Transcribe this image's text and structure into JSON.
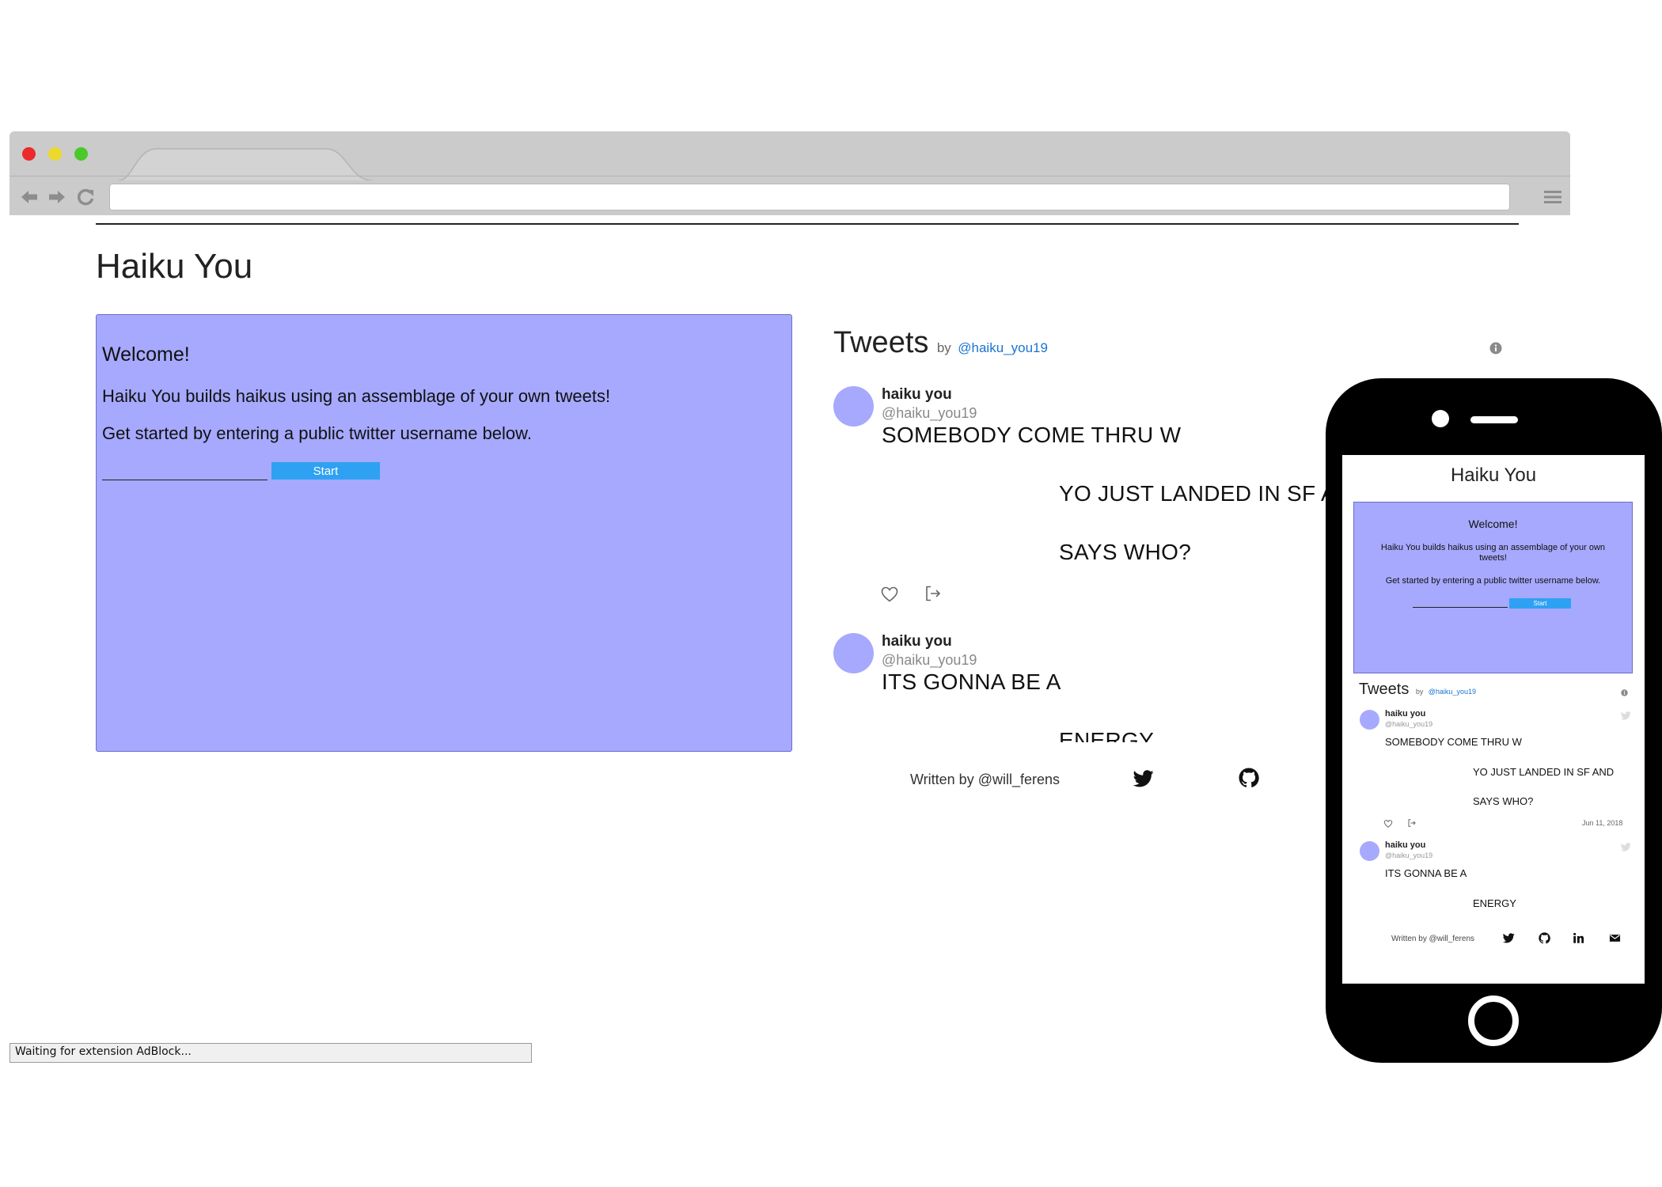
{
  "browser": {
    "address_value": "",
    "status_text": "Waiting for extension AdBlock..."
  },
  "app": {
    "title": "Haiku You",
    "welcome": {
      "heading": "Welcome!",
      "line1": "Haiku You builds haikus using an assemblage of your own tweets!",
      "line2": "Get started by entering a public twitter username below.",
      "input_value": "",
      "start_label": "Start"
    },
    "tweets": {
      "title": "Tweets",
      "by": "by",
      "handle": "@haiku_you19",
      "items": [
        {
          "name": "haiku you",
          "handle": "@haiku_you19",
          "lines": [
            "SOMEBODY COME THRU W",
            "YO JUST LANDED IN SF A",
            "SAYS WHO?"
          ]
        },
        {
          "name": "haiku you",
          "handle": "@haiku_you19",
          "lines": [
            "ITS GONNA BE A",
            "ENERGY"
          ]
        }
      ]
    },
    "footer": {
      "text": "Written by @will_ferens"
    }
  },
  "mobile": {
    "title": "Haiku You",
    "welcome": {
      "heading": "Welcome!",
      "line1": "Haiku You builds haikus using an assemblage of your own tweets!",
      "line2": "Get started by entering a public twitter username below.",
      "start_label": "Start"
    },
    "tweets": {
      "title": "Tweets",
      "by": "by",
      "handle": "@haiku_you19",
      "items": [
        {
          "name": "haiku you",
          "handle": "@haiku_you19",
          "lines": [
            "SOMEBODY COME THRU W",
            "YO JUST LANDED IN SF AND",
            "SAYS WHO?"
          ],
          "date": "Jun 11, 2018"
        },
        {
          "name": "haiku you",
          "handle": "@haiku_you19",
          "lines": [
            "ITS GONNA BE A",
            "ENERGY"
          ]
        }
      ]
    },
    "footer": {
      "text": "Written by @will_ferens",
      "icons": [
        "twitter-icon",
        "github-icon",
        "linkedin-icon",
        "mail-icon"
      ]
    }
  },
  "colors": {
    "panel": "#a6a9fd",
    "accent_button": "#2ea1f2",
    "link": "#1b74d1",
    "chrome": "#cbcbcb"
  }
}
